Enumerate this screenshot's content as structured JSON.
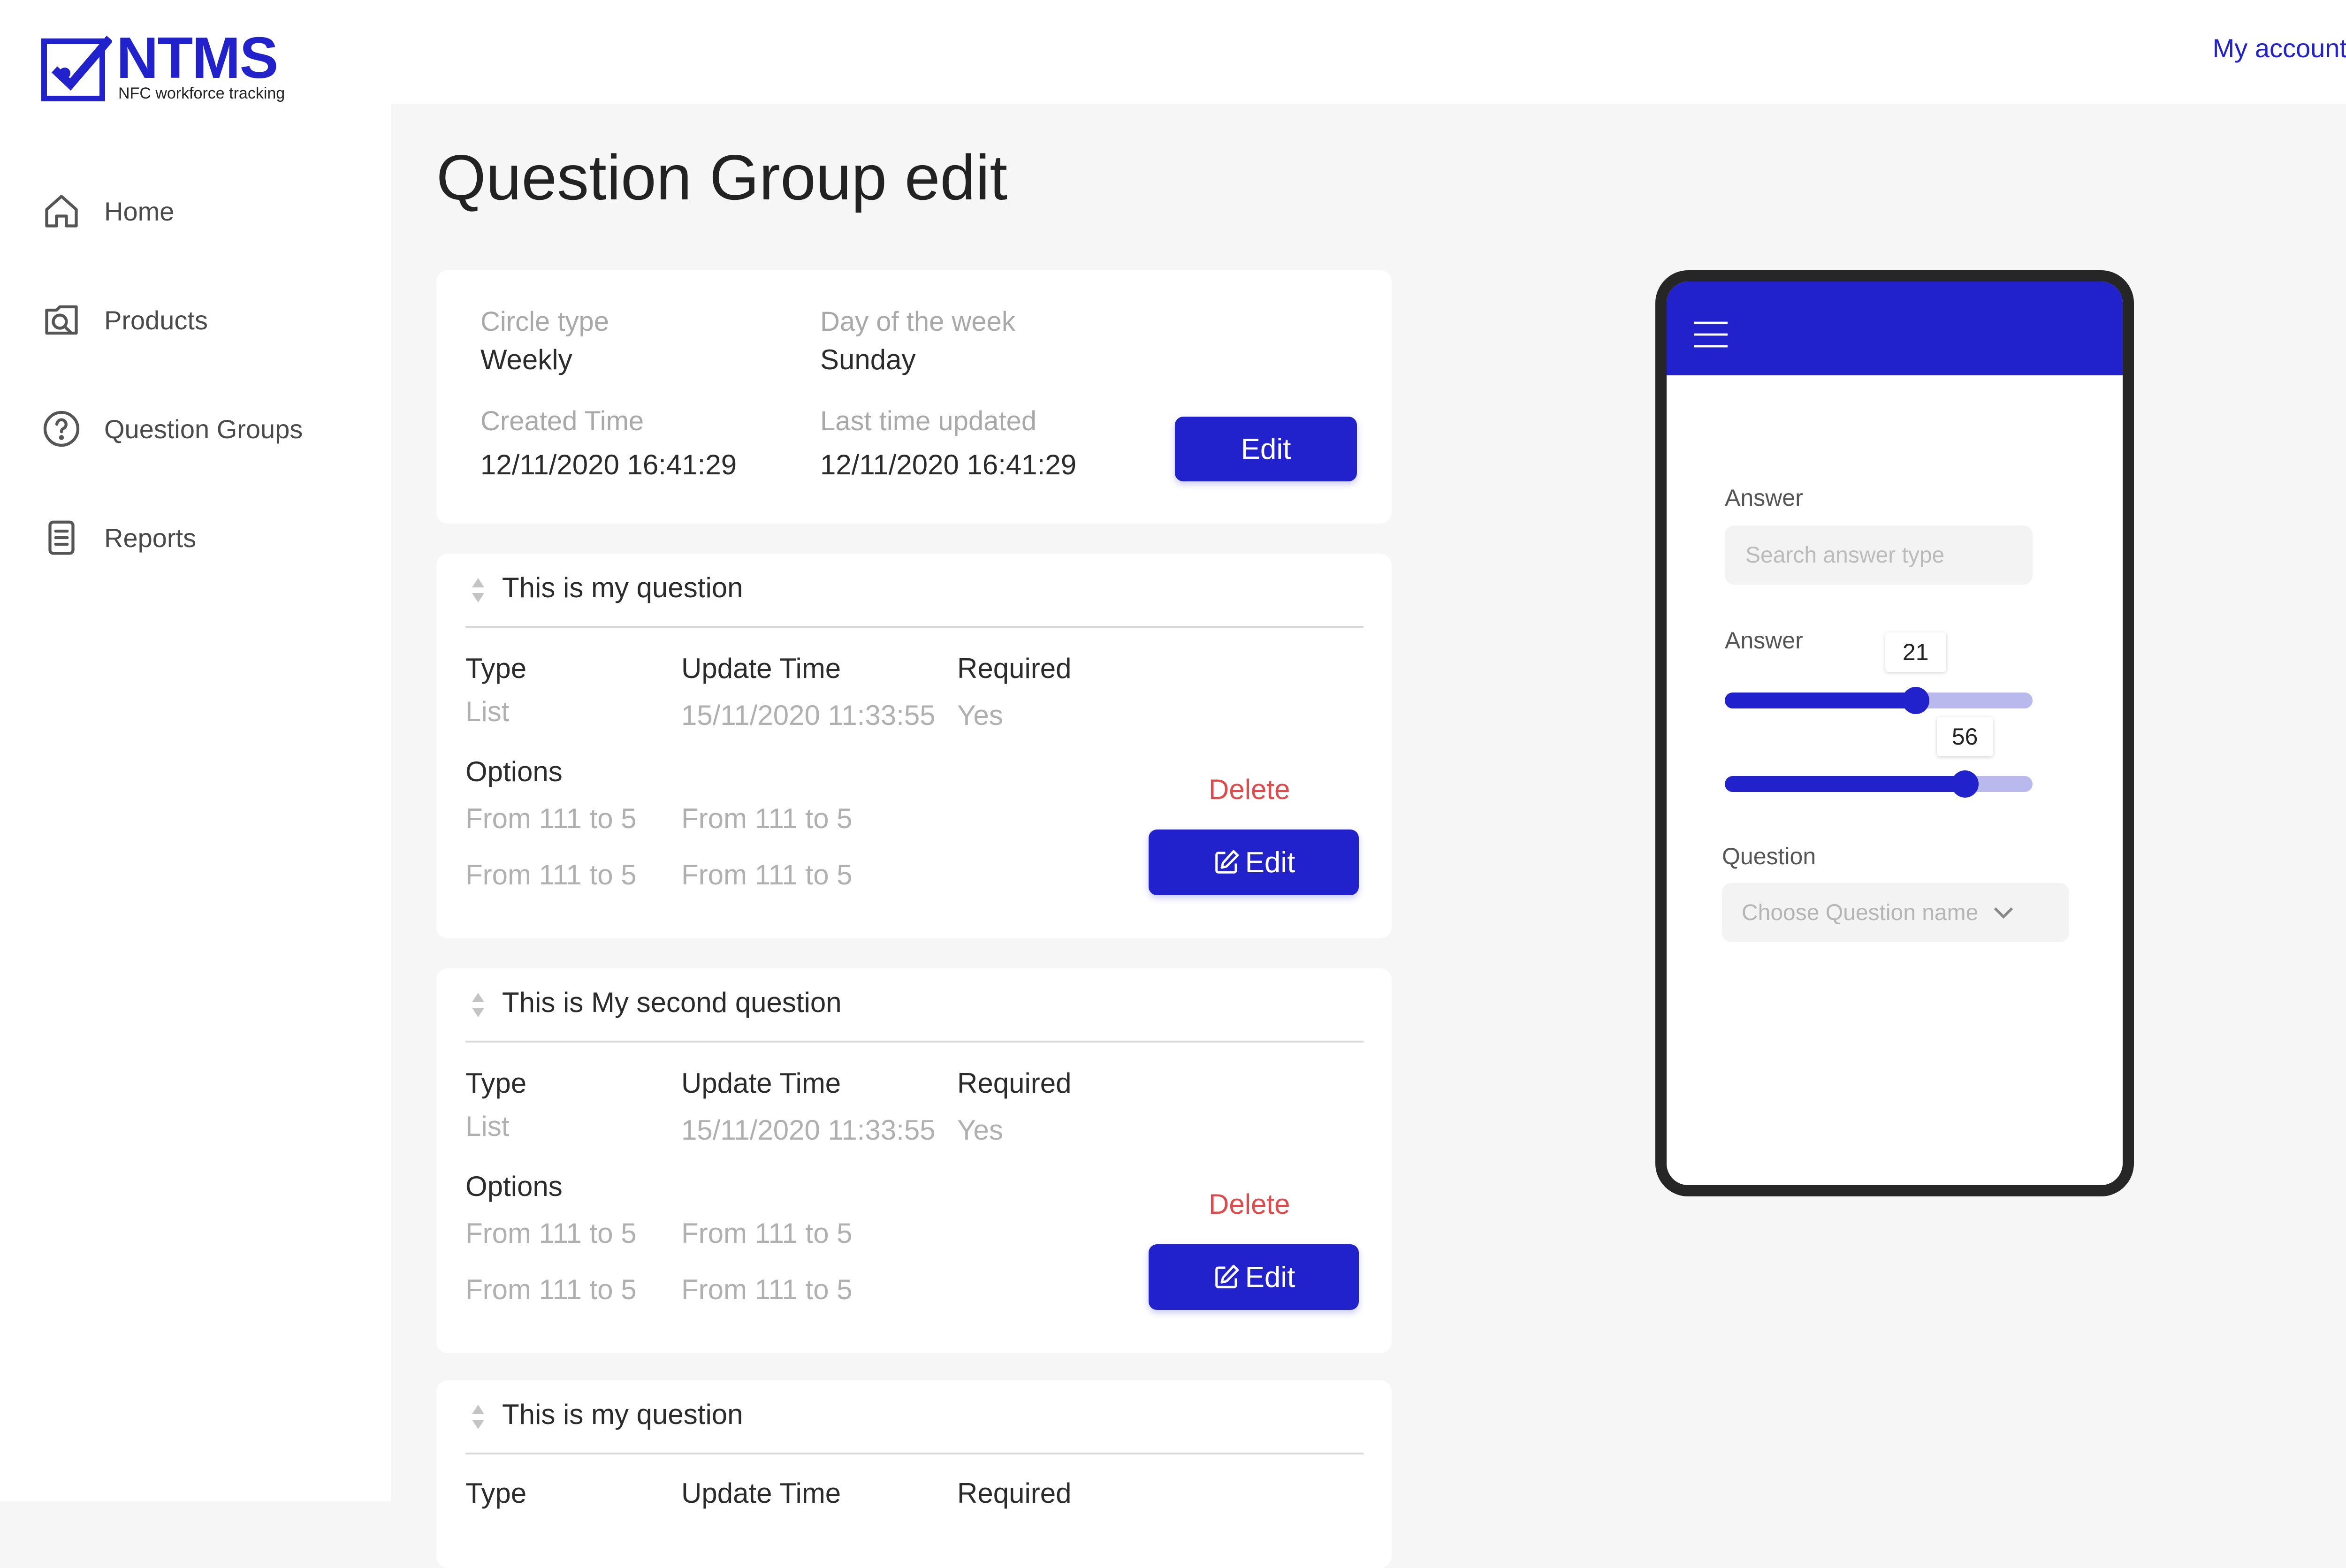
{
  "brand": {
    "name": "NTMS",
    "tagline": "NFC workforce tracking",
    "accent": "#2222cc"
  },
  "account": {
    "label": "My account"
  },
  "sidebar": {
    "items": [
      {
        "label": "Home",
        "icon": "home-icon"
      },
      {
        "label": "Products",
        "icon": "product-search-icon"
      },
      {
        "label": "Question Groups",
        "icon": "question-circle-icon"
      },
      {
        "label": "Reports",
        "icon": "report-icon"
      }
    ]
  },
  "page": {
    "title": "Question Group edit"
  },
  "summary": {
    "circle_type_label": "Circle type",
    "circle_type_value": "Weekly",
    "day_label": "Day of the week",
    "day_value": "Sunday",
    "created_label": "Created Time",
    "created_value": "12/11/2020 16:41:29",
    "updated_label": "Last time updated",
    "updated_value": "12/11/2020 16:41:29",
    "edit_label": "Edit"
  },
  "questions": [
    {
      "title": "This is my question",
      "type_label": "Type",
      "type_value": "List",
      "update_label": "Update Time",
      "update_value": "15/11/2020 11:33:55",
      "required_label": "Required",
      "required_value": "Yes",
      "options_label": "Options",
      "options": [
        "From 111 to 5",
        "From 111 to 5",
        "From 111 to 5",
        "From 111 to 5"
      ],
      "delete_label": "Delete",
      "edit_label": "Edit"
    },
    {
      "title": "This is My second question",
      "type_label": "Type",
      "type_value": "List",
      "update_label": "Update Time",
      "update_value": "15/11/2020 11:33:55",
      "required_label": "Required",
      "required_value": "Yes",
      "options_label": "Options",
      "options": [
        "From 111 to 5",
        "From 111 to 5",
        "From 111 to 5",
        "From 111 to 5"
      ],
      "delete_label": "Delete",
      "edit_label": "Edit"
    },
    {
      "title": "This is my question",
      "type_label": "Type",
      "update_label": "Update Time",
      "required_label": "Required"
    }
  ],
  "phone": {
    "answer_label_1": "Answer",
    "answer_placeholder": "Search answer type",
    "answer_label_2": "Answer",
    "slider_1_value": "21",
    "slider_1_fill": 0.62,
    "slider_2_value": "56",
    "slider_2_fill": 0.78,
    "question_label": "Question",
    "question_placeholder": "Choose Question name"
  }
}
